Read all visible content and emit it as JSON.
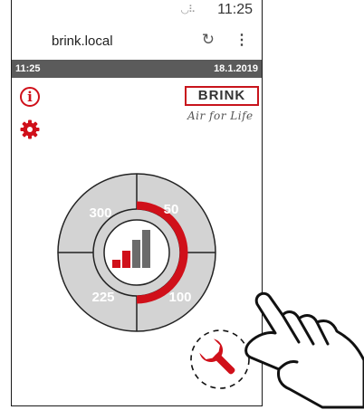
{
  "statusbar": {
    "time": "11:25",
    "signal_glyph": "◡⠧"
  },
  "browser": {
    "url": "brink.local",
    "reload_glyph": "↻",
    "menu_glyph": "⋮"
  },
  "header": {
    "time": "11:25",
    "date": "18.1.2019"
  },
  "brand": {
    "name": "BRINK",
    "tagline": "Air for Life",
    "accent": "#c8141c"
  },
  "icons": {
    "info": "info-icon",
    "settings": "gear-icon",
    "service": "wrench-icon",
    "info_glyph": "i"
  },
  "dial": {
    "speeds": [
      {
        "label": "50",
        "quadrant": "top-right"
      },
      {
        "label": "100",
        "quadrant": "bottom-right"
      },
      {
        "label": "225",
        "quadrant": "bottom-left"
      },
      {
        "label": "300",
        "quadrant": "top-left"
      }
    ],
    "active_arc": "right-half",
    "level_indicator_bars": 4,
    "level_active_bars": 2
  }
}
